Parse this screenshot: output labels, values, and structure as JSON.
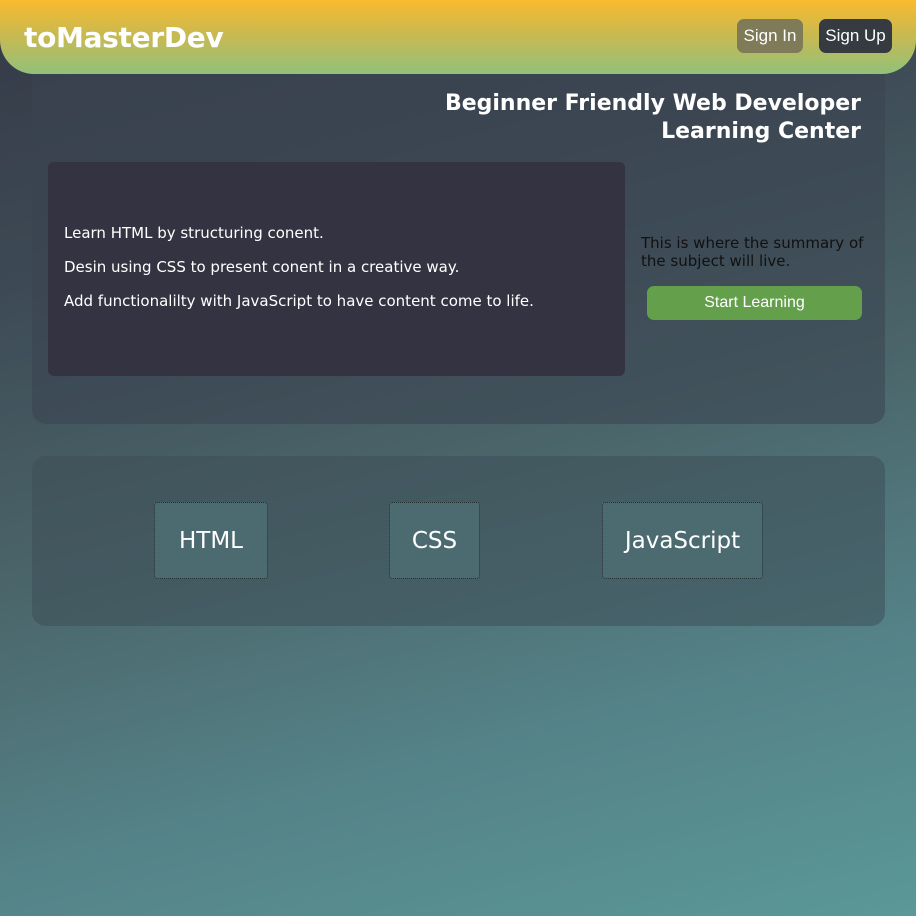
{
  "header": {
    "logo": "toMasterDev",
    "sign_in_label": "Sign In",
    "sign_up_label": "Sign Up"
  },
  "hero": {
    "title_line1": "Beginner Friendly Web Developer",
    "title_line2": "Learning Center",
    "learn_items": [
      "Learn HTML by structuring conent.",
      "Desin using CSS to present conent in a creative way.",
      "Add functionalilty with JavaScript to have content come to life."
    ],
    "summary": "This is where the summary of the subject will live.",
    "start_label": "Start Learning"
  },
  "topics": [
    {
      "label": "HTML"
    },
    {
      "label": "CSS"
    },
    {
      "label": "JavaScript"
    }
  ],
  "colors": {
    "header_top": "#f8bb2e",
    "header_bottom": "#92c17a",
    "sign_in_bg": "#7f7a57",
    "sign_up_bg": "#353b41",
    "learn_box_bg": "#343341",
    "start_button_bg": "#64a04c",
    "topic_bg": "#4c6b70"
  }
}
